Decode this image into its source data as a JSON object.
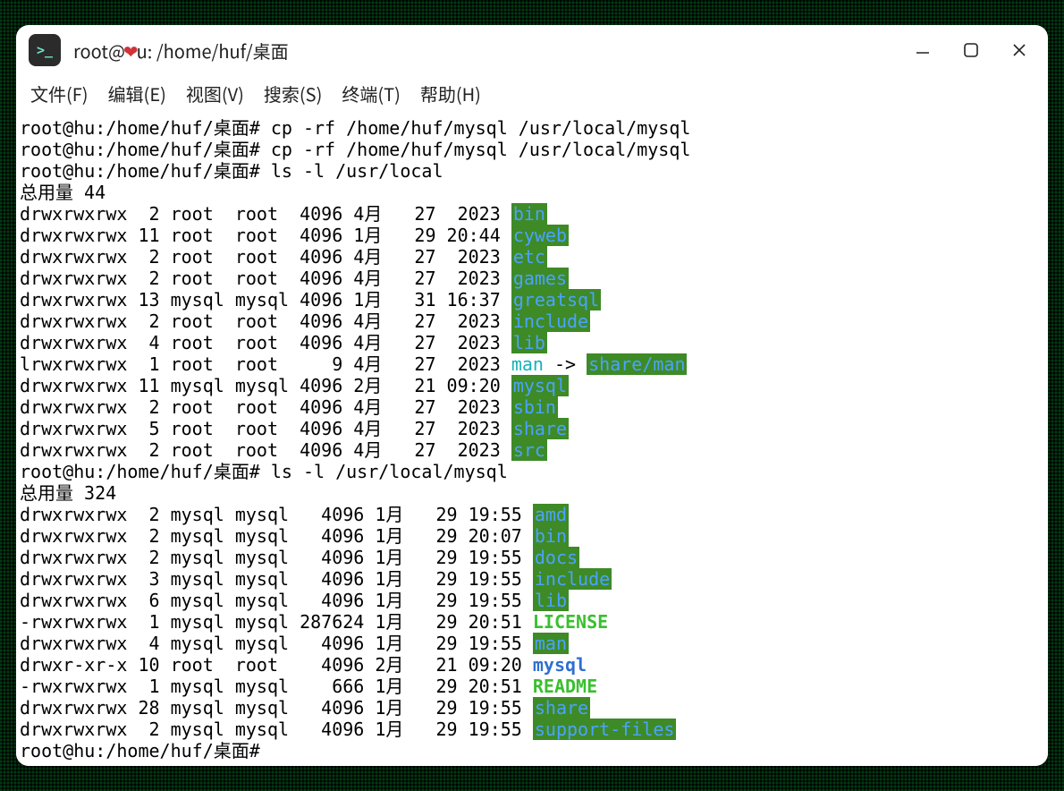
{
  "titlebar": {
    "prefix": "root@",
    "host_suffix": "u",
    "path": ": /home/huf/桌面"
  },
  "menu": [
    "文件(F)",
    "编辑(E)",
    "视图(V)",
    "搜索(S)",
    "终端(T)",
    "帮助(H)"
  ],
  "prompt": "root@hu:/home/huf/桌面#",
  "commands": [
    "cp -rf /home/huf/mysql /usr/local/mysql",
    "cp -rf /home/huf/mysql /usr/local/mysql",
    "ls -l /usr/local"
  ],
  "listing1": {
    "total_label": "总用量 44",
    "rows": [
      {
        "perm": "drwxrwxrwx",
        "lnk": " 2",
        "owner": "root ",
        "group": "root ",
        "size": "4096",
        "month": "4月 ",
        "day": " 27",
        "time": " 2023",
        "name": "bin",
        "style": "dir"
      },
      {
        "perm": "drwxrwxrwx",
        "lnk": "11",
        "owner": "root ",
        "group": "root ",
        "size": "4096",
        "month": "1月 ",
        "day": " 29",
        "time": "20:44",
        "name": "cyweb",
        "style": "dir"
      },
      {
        "perm": "drwxrwxrwx",
        "lnk": " 2",
        "owner": "root ",
        "group": "root ",
        "size": "4096",
        "month": "4月 ",
        "day": " 27",
        "time": " 2023",
        "name": "etc",
        "style": "dir"
      },
      {
        "perm": "drwxrwxrwx",
        "lnk": " 2",
        "owner": "root ",
        "group": "root ",
        "size": "4096",
        "month": "4月 ",
        "day": " 27",
        "time": " 2023",
        "name": "games",
        "style": "dir"
      },
      {
        "perm": "drwxrwxrwx",
        "lnk": "13",
        "owner": "mysql",
        "group": "mysql",
        "size": "4096",
        "month": "1月 ",
        "day": " 31",
        "time": "16:37",
        "name": "greatsql",
        "style": "dir"
      },
      {
        "perm": "drwxrwxrwx",
        "lnk": " 2",
        "owner": "root ",
        "group": "root ",
        "size": "4096",
        "month": "4月 ",
        "day": " 27",
        "time": " 2023",
        "name": "include",
        "style": "dir"
      },
      {
        "perm": "drwxrwxrwx",
        "lnk": " 4",
        "owner": "root ",
        "group": "root ",
        "size": "4096",
        "month": "4月 ",
        "day": " 27",
        "time": " 2023",
        "name": "lib",
        "style": "dir"
      },
      {
        "perm": "lrwxrwxrwx",
        "lnk": " 1",
        "owner": "root ",
        "group": "root ",
        "size": "   9",
        "month": "4月 ",
        "day": " 27",
        "time": " 2023",
        "name": "man",
        "style": "lnk",
        "arrow": " -> ",
        "target": "share/man",
        "targetstyle": "dir"
      },
      {
        "perm": "drwxrwxrwx",
        "lnk": "11",
        "owner": "mysql",
        "group": "mysql",
        "size": "4096",
        "month": "2月 ",
        "day": " 21",
        "time": "09:20",
        "name": "mysql",
        "style": "dir"
      },
      {
        "perm": "drwxrwxrwx",
        "lnk": " 2",
        "owner": "root ",
        "group": "root ",
        "size": "4096",
        "month": "4月 ",
        "day": " 27",
        "time": " 2023",
        "name": "sbin",
        "style": "dir"
      },
      {
        "perm": "drwxrwxrwx",
        "lnk": " 5",
        "owner": "root ",
        "group": "root ",
        "size": "4096",
        "month": "4月 ",
        "day": " 27",
        "time": " 2023",
        "name": "share",
        "style": "dir"
      },
      {
        "perm": "drwxrwxrwx",
        "lnk": " 2",
        "owner": "root ",
        "group": "root ",
        "size": "4096",
        "month": "4月 ",
        "day": " 27",
        "time": " 2023",
        "name": "src",
        "style": "dir"
      }
    ]
  },
  "command4": "ls -l /usr/local/mysql",
  "listing2": {
    "total_label": "总用量 324",
    "rows": [
      {
        "perm": "drwxrwxrwx",
        "lnk": " 2",
        "owner": "mysql",
        "group": "mysql",
        "size": "  4096",
        "month": "1月 ",
        "day": " 29",
        "time": "19:55",
        "name": "amd",
        "style": "dir"
      },
      {
        "perm": "drwxrwxrwx",
        "lnk": " 2",
        "owner": "mysql",
        "group": "mysql",
        "size": "  4096",
        "month": "1月 ",
        "day": " 29",
        "time": "20:07",
        "name": "bin",
        "style": "dir"
      },
      {
        "perm": "drwxrwxrwx",
        "lnk": " 2",
        "owner": "mysql",
        "group": "mysql",
        "size": "  4096",
        "month": "1月 ",
        "day": " 29",
        "time": "19:55",
        "name": "docs",
        "style": "dir"
      },
      {
        "perm": "drwxrwxrwx",
        "lnk": " 3",
        "owner": "mysql",
        "group": "mysql",
        "size": "  4096",
        "month": "1月 ",
        "day": " 29",
        "time": "19:55",
        "name": "include",
        "style": "dir"
      },
      {
        "perm": "drwxrwxrwx",
        "lnk": " 6",
        "owner": "mysql",
        "group": "mysql",
        "size": "  4096",
        "month": "1月 ",
        "day": " 29",
        "time": "19:55",
        "name": "lib",
        "style": "dir"
      },
      {
        "perm": "-rwxrwxrwx",
        "lnk": " 1",
        "owner": "mysql",
        "group": "mysql",
        "size": "287624",
        "month": "1月 ",
        "day": " 29",
        "time": "20:51",
        "name": "LICENSE",
        "style": "exe"
      },
      {
        "perm": "drwxrwxrwx",
        "lnk": " 4",
        "owner": "mysql",
        "group": "mysql",
        "size": "  4096",
        "month": "1月 ",
        "day": " 29",
        "time": "19:55",
        "name": "man",
        "style": "dir"
      },
      {
        "perm": "drwxr-xr-x",
        "lnk": "10",
        "owner": "root ",
        "group": "root ",
        "size": "  4096",
        "month": "2月 ",
        "day": " 21",
        "time": "09:20",
        "name": "mysql",
        "style": "plaindir"
      },
      {
        "perm": "-rwxrwxrwx",
        "lnk": " 1",
        "owner": "mysql",
        "group": "mysql",
        "size": "   666",
        "month": "1月 ",
        "day": " 29",
        "time": "20:51",
        "name": "README",
        "style": "exe"
      },
      {
        "perm": "drwxrwxrwx",
        "lnk": "28",
        "owner": "mysql",
        "group": "mysql",
        "size": "  4096",
        "month": "1月 ",
        "day": " 29",
        "time": "19:55",
        "name": "share",
        "style": "dir"
      },
      {
        "perm": "drwxrwxrwx",
        "lnk": " 2",
        "owner": "mysql",
        "group": "mysql",
        "size": "  4096",
        "month": "1月 ",
        "day": " 29",
        "time": "19:55",
        "name": "support-files",
        "style": "dir"
      }
    ]
  }
}
